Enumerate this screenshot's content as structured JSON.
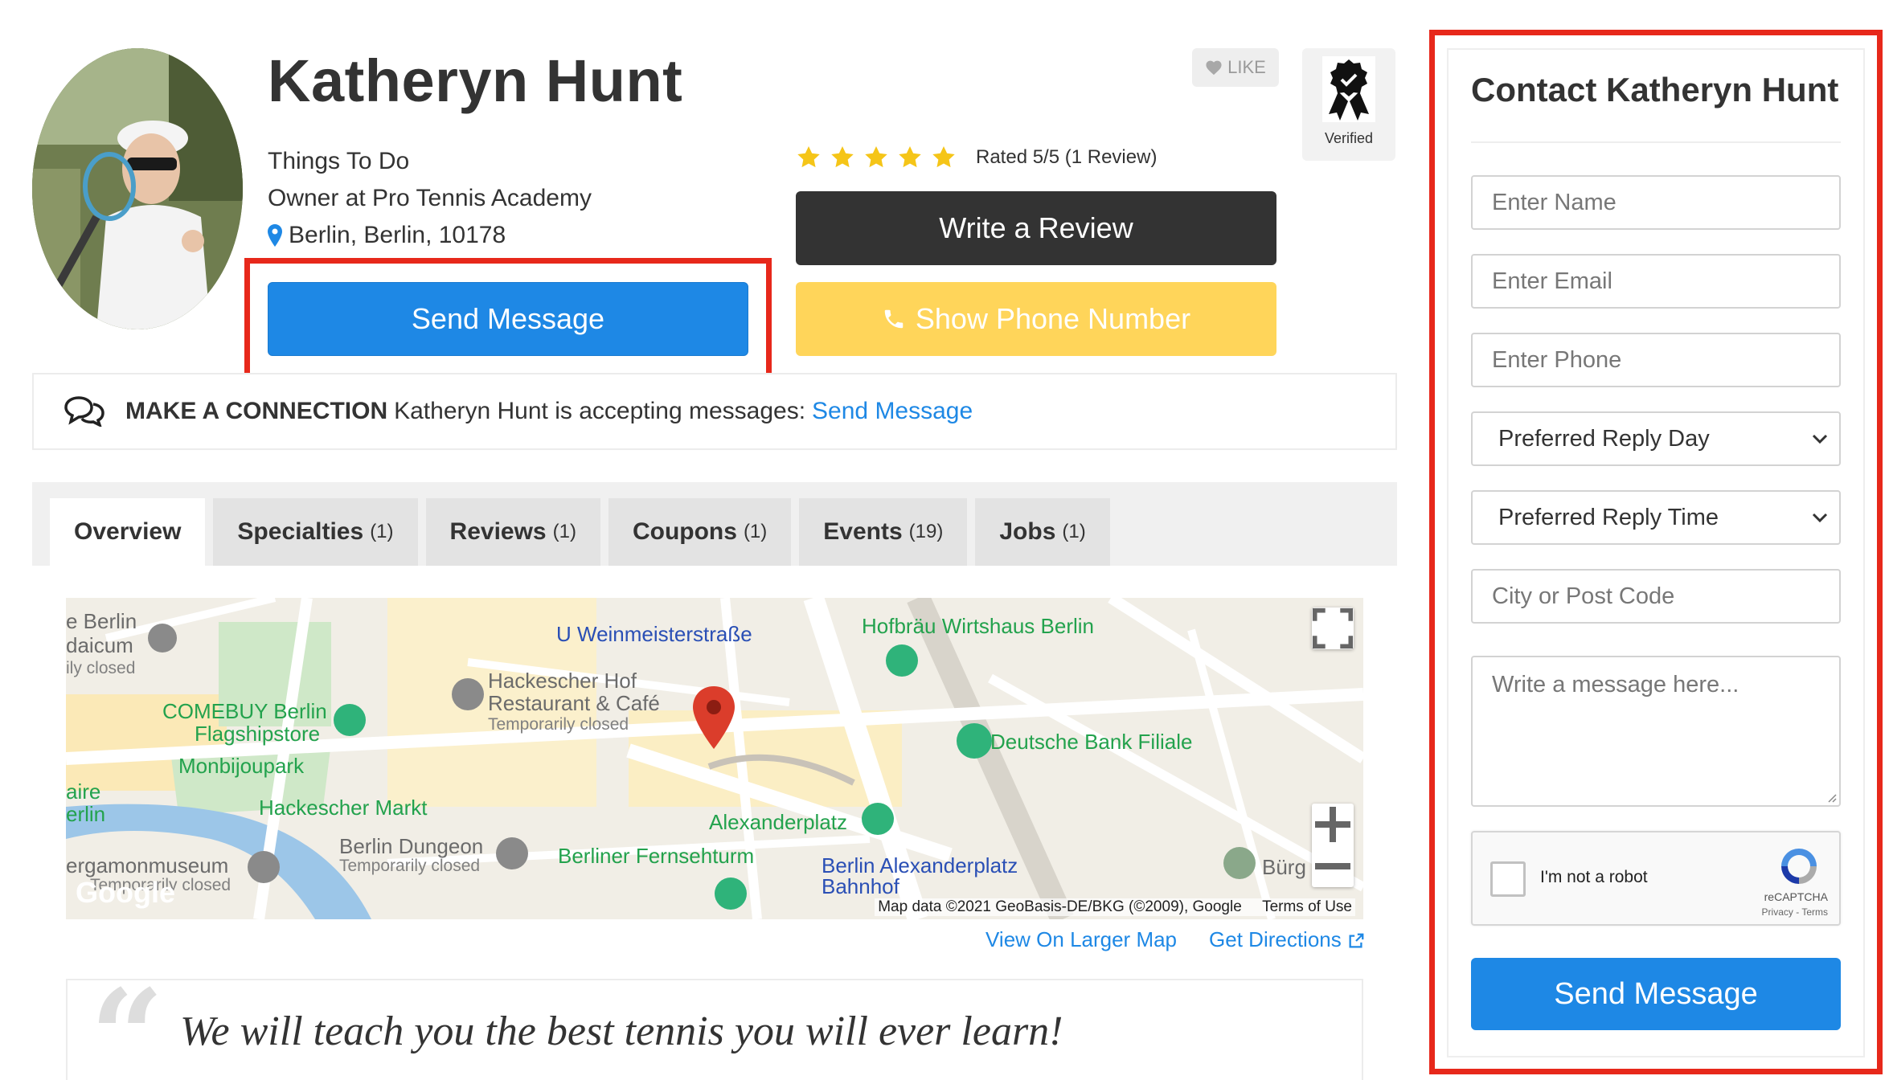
{
  "profile": {
    "name": "Katheryn Hunt",
    "category": "Things To Do",
    "role": "Owner at Pro Tennis Academy",
    "location": "Berlin, Berlin, 10178",
    "send_message_label": "Send Message",
    "write_review_label": "Write a Review",
    "show_phone_label": "Show Phone Number",
    "rating_text": "Rated 5/5 (1 Review)",
    "rating_value": 5,
    "rating_max": 5,
    "like_label": "LIKE",
    "verified_label": "Verified",
    "star_color": "#f5c518",
    "accent_color": "#1e88e5"
  },
  "connection": {
    "title": "MAKE A CONNECTION",
    "text": "Katheryn Hunt is accepting messages:",
    "link_label": "Send Message"
  },
  "tabs": [
    {
      "label": "Overview",
      "count": ""
    },
    {
      "label": "Specialties",
      "count": "(1)"
    },
    {
      "label": "Reviews",
      "count": "(1)"
    },
    {
      "label": "Coupons",
      "count": "(1)"
    },
    {
      "label": "Events",
      "count": "(19)"
    },
    {
      "label": "Jobs",
      "count": "(1)"
    }
  ],
  "map": {
    "labels": {
      "berlin_daicum": "e Berlin",
      "daicum": "daicum",
      "daily_closed": "ily closed",
      "weinmeister": "U Weinmeisterstraße",
      "hofbrau": "Hofbräu Wirtshaus Berlin",
      "hackescher_hof": "Hackescher Hof",
      "restaurant": "Restaurant & Café",
      "temp_closed_1": "Temporarily closed",
      "comebuy": "COMEBUY Berlin",
      "flagshipstore": "Flagshipstore",
      "deutsche_bank": "Deutsche Bank Filiale",
      "monbijoupark": "Monbijoupark",
      "hackescher_markt": "Hackescher Markt",
      "alexanderplatz": "Alexanderplatz",
      "berlin_dungeon": "Berlin Dungeon",
      "temp_closed_2": "Temporarily closed",
      "pergamonmuseum": "ergamonmuseum",
      "temp_closed_3": "Temporarily closed",
      "fernsehturm": "Berliner Fernsehturm",
      "bahnhof_1": "Berlin Alexanderplatz",
      "bahnhof_2": "Bahnhof",
      "burg": "Bürg",
      "aire": "aire",
      "erlin": "erlin",
      "google": "Google"
    },
    "attribution": "Map data ©2021 GeoBasis-DE/BKG (©2009), Google",
    "terms": "Terms of Use",
    "view_larger": "View On Larger Map",
    "directions": "Get Directions"
  },
  "quote": {
    "text": "We will teach you the best tennis you will ever learn!"
  },
  "contact_form": {
    "title": "Contact Katheryn Hunt",
    "name_placeholder": "Enter Name",
    "email_placeholder": "Enter Email",
    "phone_placeholder": "Enter Phone",
    "reply_day": "Preferred Reply Day",
    "reply_time": "Preferred Reply Time",
    "city_placeholder": "City or Post Code",
    "message_placeholder": "Write a message here...",
    "captcha_label": "I'm not a robot",
    "captcha_brand": "reCAPTCHA",
    "captcha_sub": "Privacy - Terms",
    "submit_label": "Send Message"
  }
}
